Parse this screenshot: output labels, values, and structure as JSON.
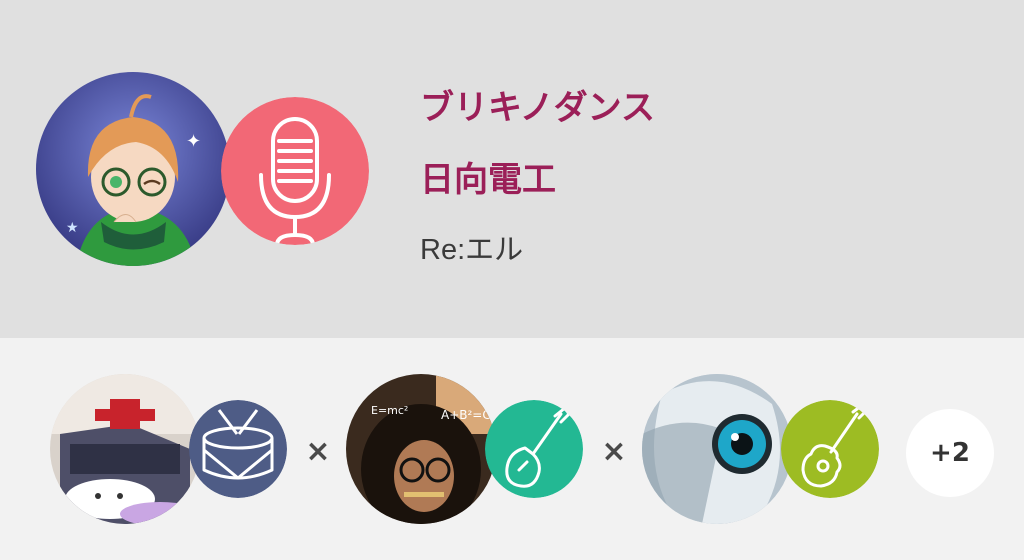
{
  "song": {
    "title": "ブリキノダンス",
    "artist": "日向電工",
    "vocal": "Re:エル"
  },
  "role_icons": {
    "main": "microphone-icon",
    "member1": "drum-icon",
    "member2": "guitar-icon",
    "member3": "guitar-icon"
  },
  "separator": "×",
  "more_members": "+2",
  "colors": {
    "title": "#9b1f58",
    "mic_badge": "#f26876",
    "drum_badge": "#4e5c86",
    "guitar_badge_teal": "#23b893",
    "guitar_badge_lime": "#9dbc23"
  }
}
